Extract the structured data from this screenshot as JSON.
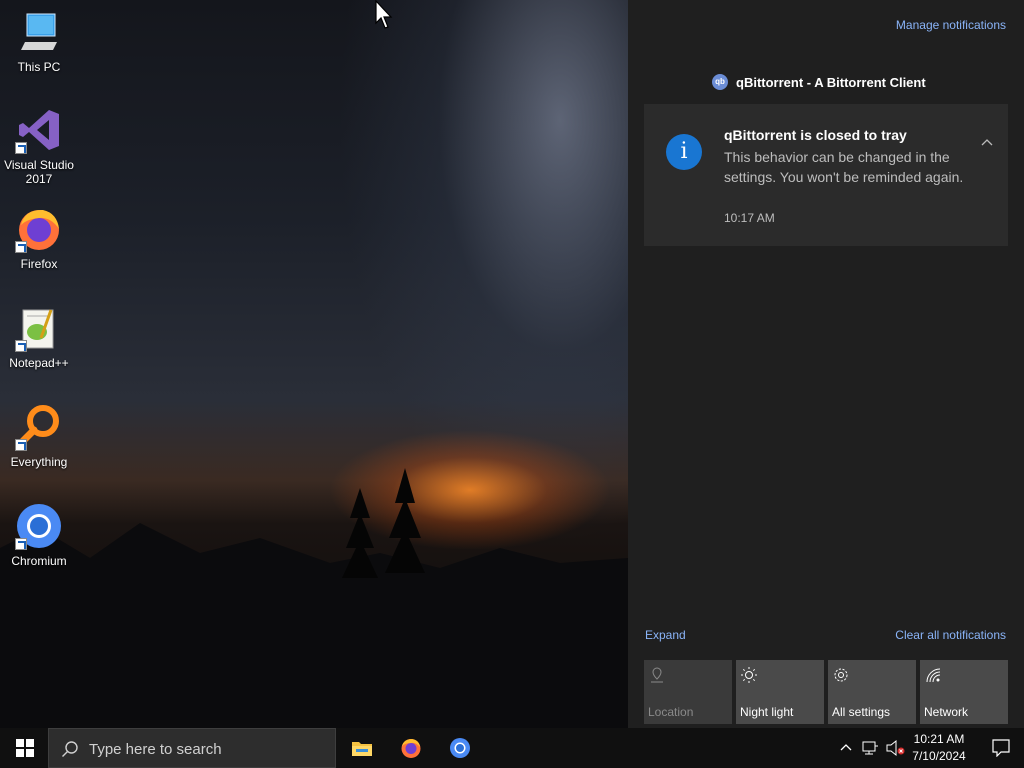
{
  "desktop": {
    "icons": [
      {
        "label": "This PC",
        "icon": "this-pc-icon"
      },
      {
        "label": "Visual Studio 2017",
        "icon": "visual-studio-icon"
      },
      {
        "label": "Firefox",
        "icon": "firefox-icon"
      },
      {
        "label": "Notepad++",
        "icon": "notepad-plus-plus-icon"
      },
      {
        "label": "Everything",
        "icon": "everything-icon"
      },
      {
        "label": "Chromium",
        "icon": "chromium-icon"
      }
    ]
  },
  "action_center": {
    "manage_link": "Manage notifications",
    "app_name": "qBittorrent - A Bittorrent Client",
    "app_icon_text": "qb",
    "notification": {
      "title": "qBittorrent is closed to tray",
      "body": "This behavior can be changed in the settings. You won't be reminded again.",
      "time": "10:17 AM",
      "icon_glyph": "i"
    },
    "expand_label": "Expand",
    "clear_label": "Clear all notifications",
    "quick_actions": [
      {
        "label": "Location",
        "icon": "location-icon",
        "enabled": false
      },
      {
        "label": "Night light",
        "icon": "night-light-icon",
        "enabled": true
      },
      {
        "label": "All settings",
        "icon": "gear-icon",
        "enabled": true
      },
      {
        "label": "Network",
        "icon": "network-icon",
        "enabled": true
      }
    ]
  },
  "taskbar": {
    "search_placeholder": "Type here to search",
    "pinned": [
      "File Explorer",
      "Firefox",
      "Chromium"
    ],
    "clock": {
      "time": "10:21 AM",
      "date": "7/10/2024"
    }
  },
  "colors": {
    "accent_link": "#8ab4f8",
    "action_center_bg": "#1f1f1f",
    "toast_bg": "#2b2b2b",
    "info_icon": "#1976d2",
    "taskbar_bg": "#101010"
  }
}
